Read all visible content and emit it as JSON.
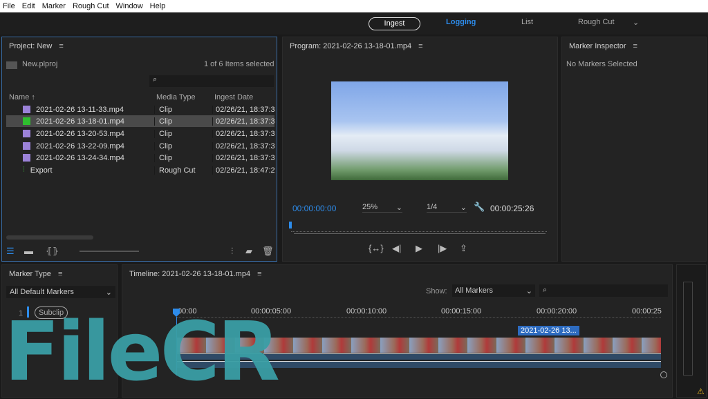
{
  "menu": [
    "File",
    "Edit",
    "Marker",
    "Rough Cut",
    "Window",
    "Help"
  ],
  "workspaces": {
    "ingest": "Ingest",
    "logging": "Logging",
    "list": "List",
    "rough_cut": "Rough Cut"
  },
  "project": {
    "title": "Project: New",
    "file": "New.plproj",
    "selection": "1 of 6 Items selected",
    "search_placeholder": "",
    "columns": [
      "Name",
      "Media Type",
      "Ingest Date"
    ],
    "rows": [
      {
        "name": "2021-02-26 13-11-33.mp4",
        "type": "Clip",
        "date": "02/26/21, 18:37:3"
      },
      {
        "name": "2021-02-26 13-18-01.mp4",
        "type": "Clip",
        "date": "02/26/21, 18:37:3"
      },
      {
        "name": "2021-02-26 13-20-53.mp4",
        "type": "Clip",
        "date": "02/26/21, 18:37:3"
      },
      {
        "name": "2021-02-26 13-22-09.mp4",
        "type": "Clip",
        "date": "02/26/21, 18:37:3"
      },
      {
        "name": "2021-02-26 13-24-34.mp4",
        "type": "Clip",
        "date": "02/26/21, 18:37:3"
      },
      {
        "name": "Export",
        "type": "Rough Cut",
        "date": "02/26/21, 18:47:2"
      }
    ]
  },
  "program": {
    "title": "Program: 2021-02-26 13-18-01.mp4",
    "current_time": "00:00:00:00",
    "zoom": "25%",
    "resolution": "1/4",
    "duration": "00:00:25:26"
  },
  "marker_inspector": {
    "title": "Marker Inspector",
    "empty": "No Markers Selected"
  },
  "marker_type": {
    "title": "Marker Type",
    "filter": "All Default Markers",
    "items": [
      {
        "num": "1",
        "label": "Subclip"
      }
    ]
  },
  "timeline": {
    "title": "Timeline: 2021-02-26 13-18-01.mp4",
    "show_label": "Show:",
    "show_value": "All Markers",
    "ticks": [
      "00:00",
      "00:00:05:00",
      "00:00:10:00",
      "00:00:15:00",
      "00:00:20:00",
      "00:00:25"
    ],
    "marker_label": "2021-02-26 13..."
  },
  "watermark": "FileCR",
  "colors": {
    "accent": "#2d8ceb",
    "selection": "#4a4a4a",
    "panel": "#232323",
    "watermark": "#3a9ea5"
  }
}
